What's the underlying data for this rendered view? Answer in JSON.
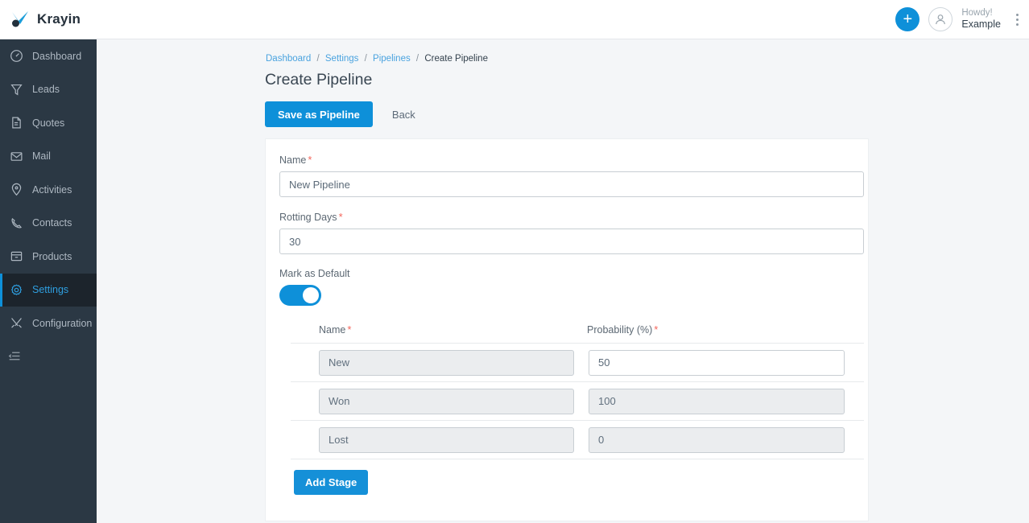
{
  "header": {
    "brand_name": "Krayin",
    "logo_icon": "krayin-logo-icon",
    "add_button_label": "+",
    "avatar_icon": "user-avatar-icon",
    "howdy_greeting": "Howdy!",
    "user_name": "Example",
    "menu_icon": "kebab-menu-icon"
  },
  "sidebar": {
    "items": [
      {
        "label": "Dashboard",
        "icon": "dashboard-icon",
        "active": false
      },
      {
        "label": "Leads",
        "icon": "funnel-icon",
        "active": false
      },
      {
        "label": "Quotes",
        "icon": "document-icon",
        "active": false
      },
      {
        "label": "Mail",
        "icon": "envelope-icon",
        "active": false
      },
      {
        "label": "Activities",
        "icon": "location-pin-icon",
        "active": false
      },
      {
        "label": "Contacts",
        "icon": "phone-icon",
        "active": false
      },
      {
        "label": "Products",
        "icon": "box-icon",
        "active": false
      },
      {
        "label": "Settings",
        "icon": "gear-icon",
        "active": true
      },
      {
        "label": "Configuration",
        "icon": "tools-icon",
        "active": false
      }
    ],
    "collapse_icon": "collapse-sidebar-icon"
  },
  "breadcrumb": {
    "items": [
      "Dashboard",
      "Settings",
      "Pipelines"
    ],
    "current": "Create Pipeline",
    "separator": "/"
  },
  "page": {
    "title": "Create Pipeline",
    "save_label": "Save as Pipeline",
    "back_label": "Back"
  },
  "form": {
    "name_label": "Name",
    "name_required": "*",
    "name_value": "New Pipeline",
    "rotting_label": "Rotting Days",
    "rotting_required": "*",
    "rotting_value": "30",
    "default_label": "Mark as Default",
    "default_on": true
  },
  "stages": {
    "col_name": "Name",
    "col_name_required": "*",
    "col_prob": "Probability (%)",
    "col_prob_required": "*",
    "rows": [
      {
        "name": "New",
        "name_disabled": true,
        "probability": "50",
        "prob_disabled": false
      },
      {
        "name": "Won",
        "name_disabled": true,
        "probability": "100",
        "prob_disabled": true
      },
      {
        "name": "Lost",
        "name_disabled": true,
        "probability": "0",
        "prob_disabled": true
      }
    ],
    "add_label": "Add Stage"
  },
  "colors": {
    "accent": "#0e90d9",
    "sidebar": "#2b3844",
    "sidebar_active": "#1c242c",
    "required": "#f4655b",
    "page_bg": "#f4f6f8"
  }
}
